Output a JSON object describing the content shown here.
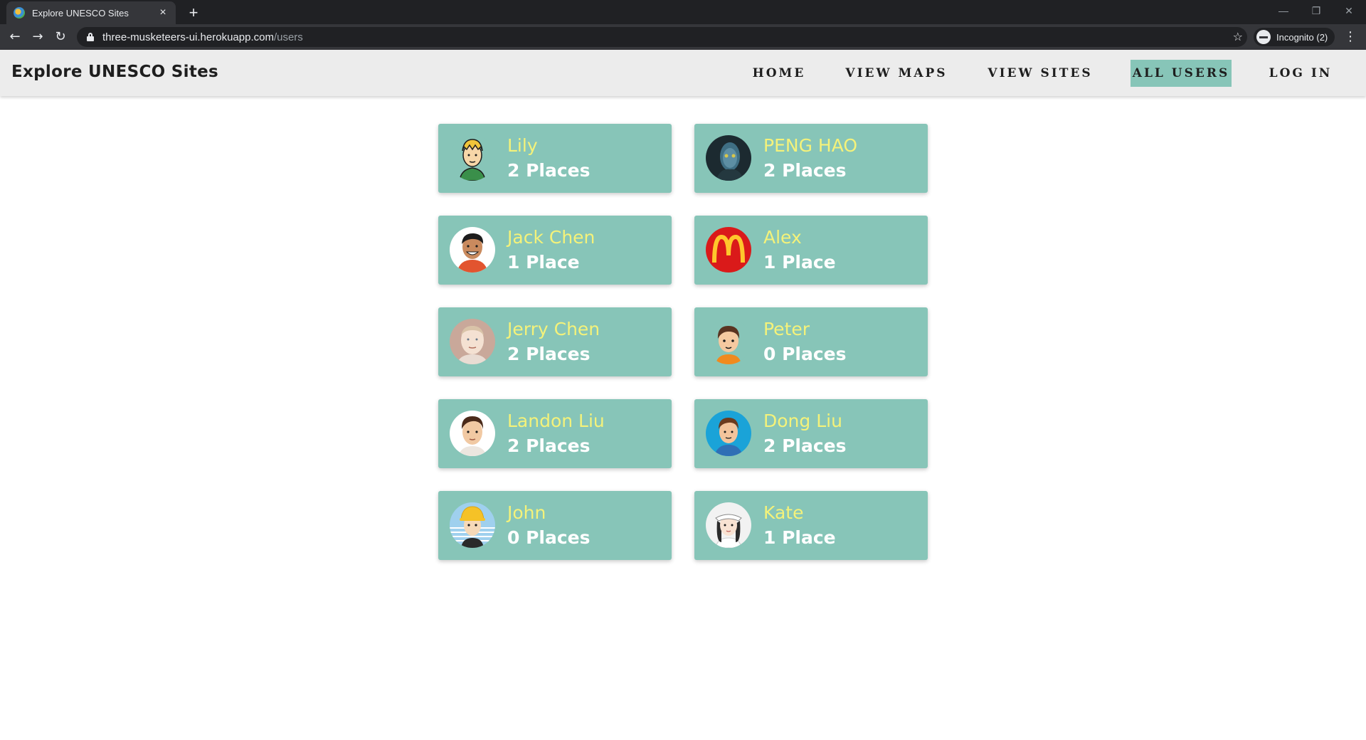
{
  "browser": {
    "tab_title": "Explore UNESCO Sites",
    "tab_close": "×",
    "new_tab": "+",
    "url_host": "three-musketeers-ui.herokuapp.com",
    "url_path": "/users",
    "incognito_label": "Incognito (2)",
    "star": "☆",
    "back": "←",
    "forward": "→",
    "reload": "↻",
    "menu": "⋮",
    "minimize": "—",
    "restore": "❐",
    "close": "✕"
  },
  "header": {
    "brand": "Explore UNESCO Sites",
    "nav": [
      {
        "label": "HOME"
      },
      {
        "label": "VIEW MAPS"
      },
      {
        "label": "VIEW SITES"
      },
      {
        "label": "ALL USERS"
      },
      {
        "label": "LOG IN"
      }
    ],
    "active_nav": "ALL USERS"
  },
  "users": [
    {
      "name": "Lily",
      "places": "2 Places",
      "avatar": "cartoon-blonde-avatar"
    },
    {
      "name": "PENG HAO",
      "places": "2 Places",
      "avatar": "avatar-movie-character-photo"
    },
    {
      "name": "Jack Chen",
      "places": "1 Place",
      "avatar": "cartoon-smiling-man-avatar"
    },
    {
      "name": "Alex",
      "places": "1 Place",
      "avatar": "golden-arches-logo-avatar"
    },
    {
      "name": "Jerry Chen",
      "places": "2 Places",
      "avatar": "cartoon-bald-man-avatar"
    },
    {
      "name": "Peter",
      "places": "0 Places",
      "avatar": "cartoon-boy-avatar"
    },
    {
      "name": "Landon Liu",
      "places": "2 Places",
      "avatar": "cartoon-man-brown-hair-avatar"
    },
    {
      "name": "Dong Liu",
      "places": "2 Places",
      "avatar": "cartoon-man-blue-circle-avatar"
    },
    {
      "name": "John",
      "places": "0 Places",
      "avatar": "cartoon-hardhat-worker-avatar"
    },
    {
      "name": "Kate",
      "places": "1 Place",
      "avatar": "cartoon-woman-visor-avatar"
    }
  ],
  "colors": {
    "card_bg": "#87c5b8",
    "name_text": "#f4f27a",
    "places_text": "#ffffff",
    "header_bg": "#ececec"
  }
}
